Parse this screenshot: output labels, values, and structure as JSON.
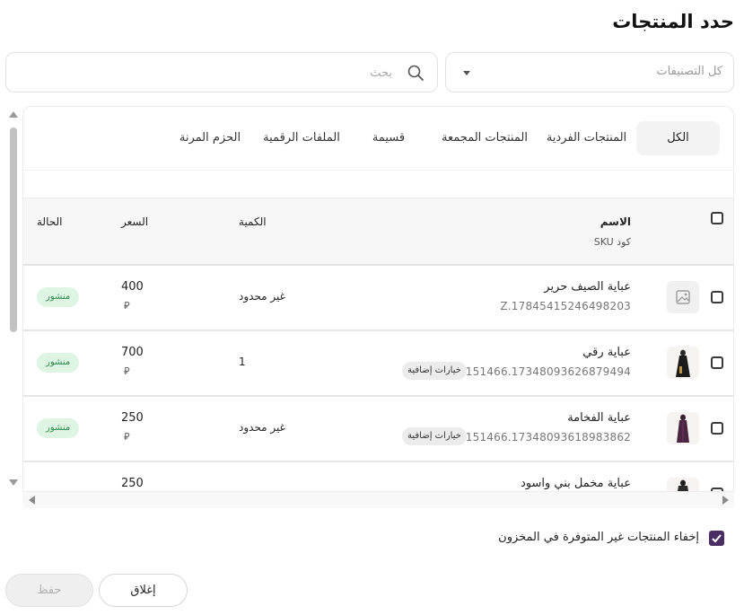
{
  "dialog": {
    "title": "حدد المنتجات"
  },
  "filters": {
    "search_placeholder": "بحث",
    "category_label": "كل التصنيفات"
  },
  "tabs": [
    {
      "label": "الكل",
      "active": true
    },
    {
      "label": "المنتجات الفردية",
      "active": false
    },
    {
      "label": "المنتجات المجمعة",
      "active": false
    },
    {
      "label": "قسيمة",
      "active": false
    },
    {
      "label": "الملفات الرقمية",
      "active": false
    },
    {
      "label": "الحزم المرنة",
      "active": false
    }
  ],
  "table": {
    "headers": {
      "name": "الاسم",
      "sku": "كود SKU",
      "quantity": "الكمية",
      "price": "السعر",
      "status": "الحالة"
    },
    "rows": [
      {
        "name": "عباية الصيف حرير",
        "sku": "Z.17845415246498203",
        "options_badge": "",
        "quantity": "غير محدود",
        "price": "400",
        "currency": "⃁",
        "status": "منشور",
        "thumb": "placeholder"
      },
      {
        "name": "عباية رقي",
        "sku": "Z.151466.17348093626879494",
        "options_badge": "خيارات إضافية",
        "quantity": "1",
        "price": "700",
        "currency": "⃁",
        "status": "منشور",
        "thumb": "photo"
      },
      {
        "name": "عباية الفخامة",
        "sku": "Z.151466.17348093618983862",
        "options_badge": "خيارات إضافية",
        "quantity": "غير محدود",
        "price": "250",
        "currency": "⃁",
        "status": "منشور",
        "thumb": "photo"
      },
      {
        "name": "عباية مخمل بني واسود",
        "sku": "",
        "options_badge": "",
        "quantity": "",
        "price": "250",
        "currency": "",
        "status": "",
        "thumb": "photo"
      }
    ]
  },
  "footer": {
    "hide_out_of_stock_label": "إخفاء المنتجات غير المتوفرة في المخزون",
    "hide_out_of_stock_checked": true,
    "close_label": "إغلاق",
    "save_label": "حفظ"
  },
  "colors": {
    "accent": "#4a2e63",
    "status_bg": "#dff5e3",
    "status_text": "#2e8b4c"
  }
}
